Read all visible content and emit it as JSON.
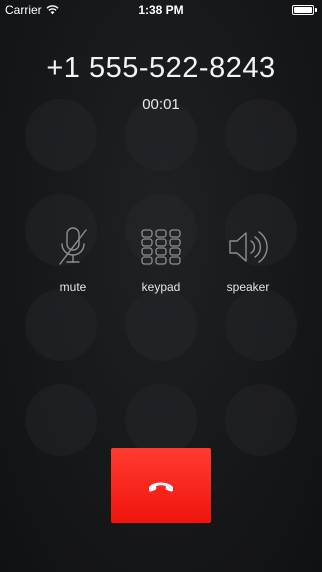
{
  "status_bar": {
    "carrier": "Carrier",
    "time": "1:38 PM",
    "wifi_icon": "wifi-icon",
    "battery_icon": "battery-full-icon"
  },
  "call": {
    "phone_number": "+1 555-522-8243",
    "duration": "00:01"
  },
  "controls": [
    {
      "label": "mute",
      "icon": "microphone-muted-icon"
    },
    {
      "label": "keypad",
      "icon": "keypad-grid-icon"
    },
    {
      "label": "speaker",
      "icon": "speaker-icon"
    }
  ],
  "end_call": {
    "icon": "phone-hangup-icon",
    "color": "#ff3b30"
  },
  "colors": {
    "background": "#17181a",
    "icon_stroke": "#8e8e93",
    "end_call_red": "#ff3b30"
  }
}
